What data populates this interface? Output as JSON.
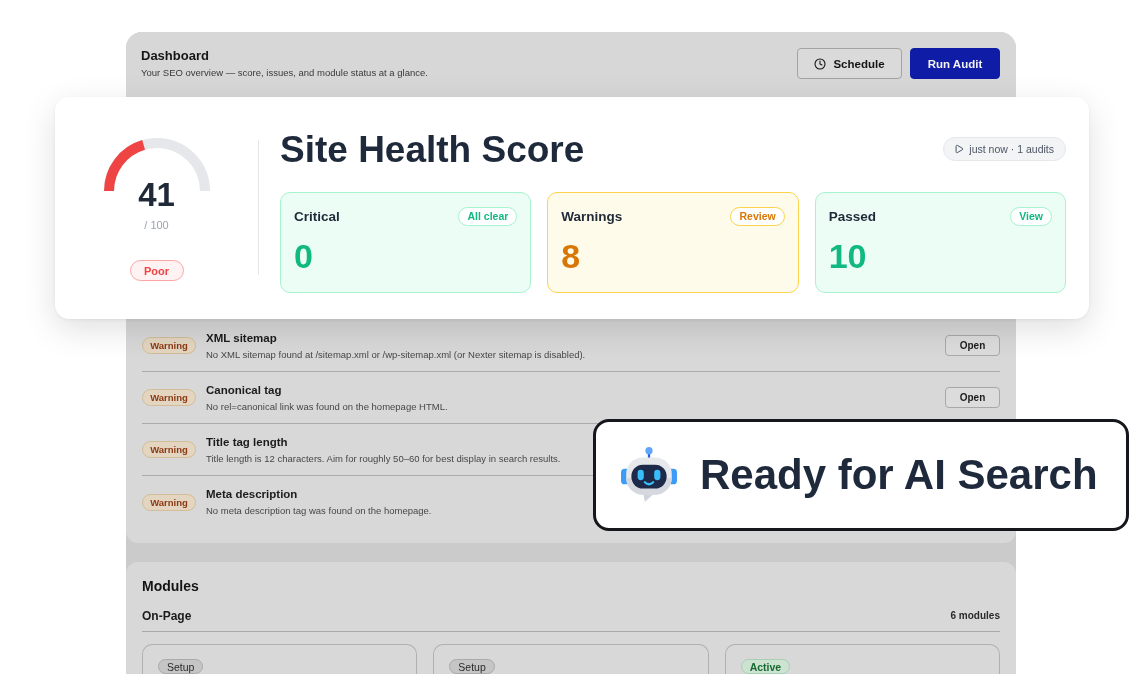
{
  "header": {
    "title": "Dashboard",
    "subtitle": "Your SEO overview — score, issues, and module status at a glance.",
    "buttons": [
      {
        "label": "Schedule",
        "kind": "secondary"
      },
      {
        "label": "Run Audit",
        "kind": "primary"
      }
    ]
  },
  "health": {
    "score": "41",
    "max": "/ 100",
    "level": 0.41,
    "rating": "Poor",
    "title": "Site Health Score",
    "last_audit": "just now · 1 audits",
    "stats": [
      {
        "label": "Critical",
        "action": "All clear",
        "value": "0",
        "kind": "success"
      },
      {
        "label": "Warnings",
        "action": "Review",
        "value": "8",
        "kind": "warning"
      },
      {
        "label": "Passed",
        "action": "View",
        "value": "10",
        "kind": "success"
      }
    ]
  },
  "issues": [
    {
      "badge": "Warning",
      "title": "XML sitemap",
      "description": "No XML sitemap found at /sitemap.xml or /wp-sitemap.xml (or Nexter sitemap is disabled).",
      "action": "Open"
    },
    {
      "badge": "Warning",
      "title": "Canonical tag",
      "description": "No rel=canonical link was found on the homepage HTML.",
      "action": "Open"
    },
    {
      "badge": "Warning",
      "title": "Title tag length",
      "description": "Title length is 12 characters. Aim for roughly 50–60 for best display in search results."
    },
    {
      "badge": "Warning",
      "title": "Meta description",
      "description": "No meta description tag was found on the homepage."
    }
  ],
  "modules": {
    "title": "Modules",
    "groups": [
      {
        "name": "On-Page",
        "count": "6 modules",
        "cards": [
          {
            "status": "Setup",
            "active": false
          },
          {
            "status": "Setup",
            "active": false
          },
          {
            "status": "Active",
            "active": true
          }
        ]
      }
    ]
  },
  "promo": {
    "text": "Ready for AI Search"
  }
}
